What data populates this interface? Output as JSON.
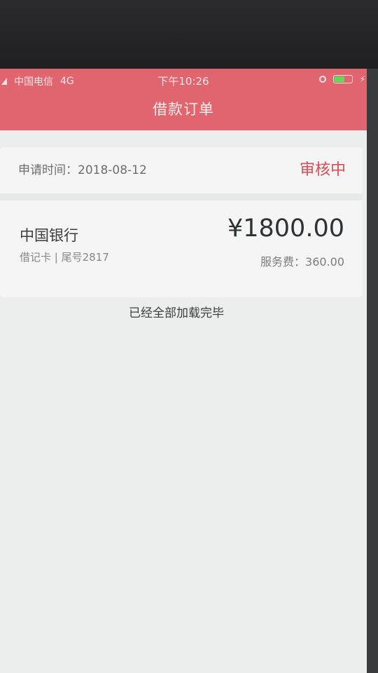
{
  "statusbar": {
    "carrier": "中国电信",
    "network": "4G",
    "time": "下午10:26"
  },
  "nav": {
    "title": "借款订单"
  },
  "order": {
    "apply_time_label": "申请时间：",
    "apply_time_value": "2018-08-12",
    "status": "审核中",
    "bank_name": "中国银行",
    "card_info": "借记卡 | 尾号2817",
    "amount": "¥1800.00",
    "fee_label": "服务费：",
    "fee_value": "360.00"
  },
  "footer": {
    "loaded_text": "已经全部加载完毕"
  },
  "colors": {
    "header": "#e0656e",
    "status_accent": "#d64d55",
    "background": "#eceeed"
  },
  "icons": {
    "signal": "signal-icon",
    "rotation_lock": "rotation-lock-icon",
    "battery": "battery-icon",
    "charging": "charging-icon"
  }
}
